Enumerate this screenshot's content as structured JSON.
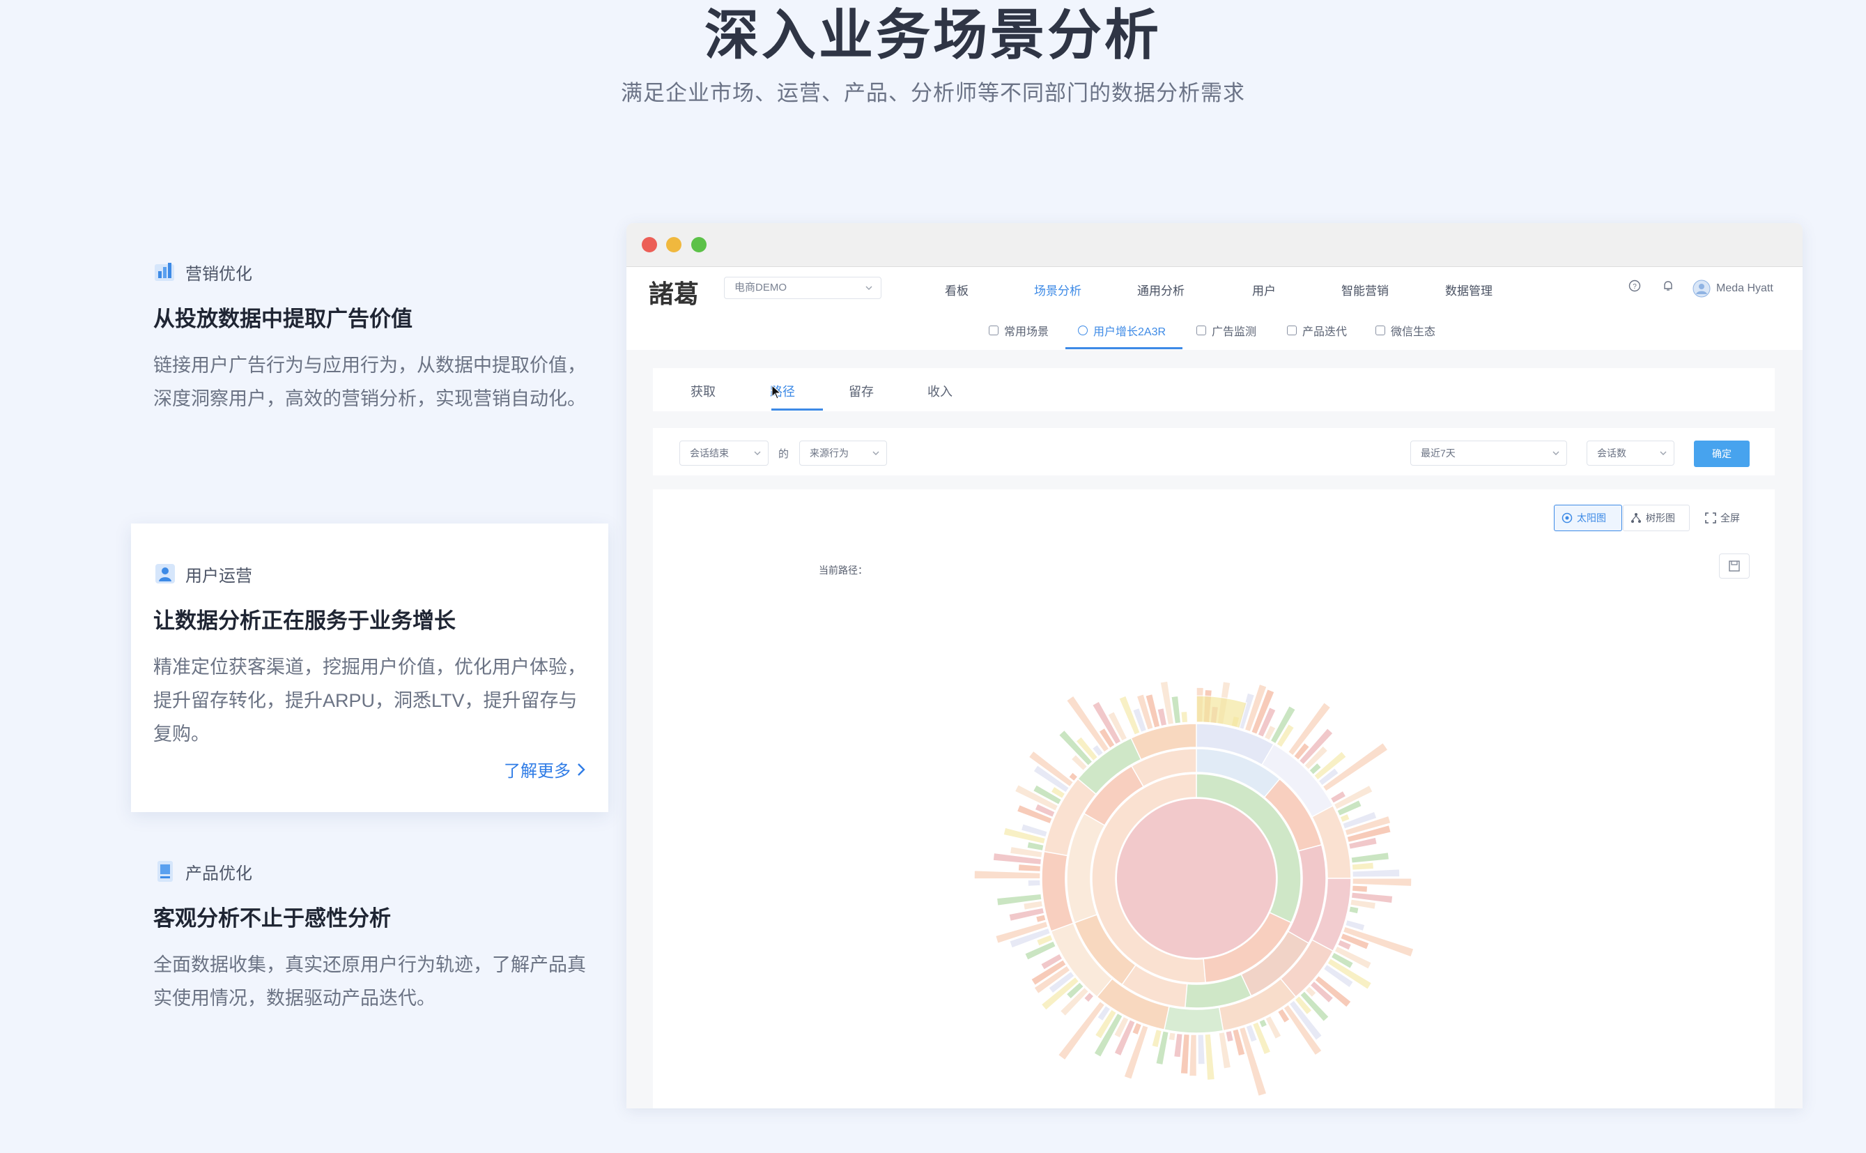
{
  "hero": {
    "title": "深入业务场景分析",
    "subtitle": "满足企业市场、运营、产品、分析师等不同部门的数据分析需求"
  },
  "features": [
    {
      "tag": "营销优化",
      "title": "从投放数据中提取广告价值",
      "desc": "链接用户广告行为与应用行为，从数据中提取价值，深度洞察用户，高效的营销分析，实现营销自动化。",
      "icon": "chart-icon"
    },
    {
      "tag": "用户运营",
      "title": "让数据分析正在服务于业务增长",
      "desc": "精准定位获客渠道，挖掘用户价值，优化用户体验，提升留存转化，提升ARPU，洞悉LTV，提升留存与复购。",
      "link": "了解更多",
      "icon": "user-icon",
      "active": true
    },
    {
      "tag": "产品优化",
      "title": "客观分析不止于感性分析",
      "desc": "全面数据收集，真实还原用户行为轨迹，了解产品真实使用情况，数据驱动产品迭代。",
      "icon": "device-icon"
    }
  ],
  "app": {
    "logo": "諸葛",
    "project": "电商DEMO",
    "nav": [
      "看板",
      "场景分析",
      "通用分析",
      "用户",
      "智能营销",
      "数据管理"
    ],
    "nav_active": "场景分析",
    "user": "Meda Hyatt",
    "subnav": [
      "常用场景",
      "用户增长2A3R",
      "广告监测",
      "产品迭代",
      "微信生态"
    ],
    "subnav_active": "用户增长2A3R",
    "tabs": [
      "获取",
      "路径",
      "留存",
      "收入"
    ],
    "tab_active": "路径",
    "filters": {
      "event": "会话结束",
      "of": "的",
      "source": "来源行为",
      "range": "最近7天",
      "metric": "会话数",
      "confirm": "确定"
    },
    "views": {
      "sunburst": "太阳图",
      "tree": "树形图",
      "fullscreen": "全屏"
    },
    "current_path_label": "当前路径："
  },
  "colors": {
    "accent": "#3d8ae6",
    "confirm": "#47a3ee",
    "window_red": "#ec5f57",
    "window_yellow": "#f0b83e",
    "window_green": "#5cc148"
  }
}
